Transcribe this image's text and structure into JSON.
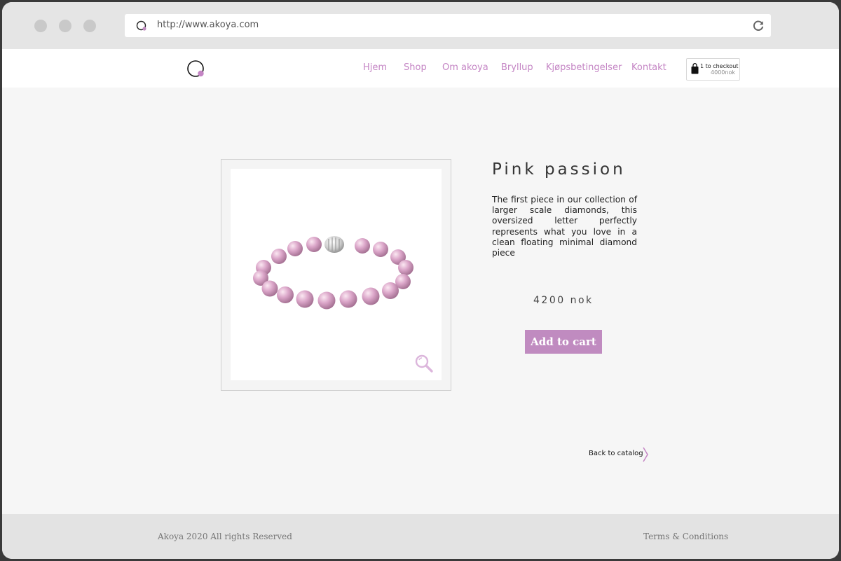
{
  "browser": {
    "url": "http://www.akoya.com",
    "icons": [
      "site-logo-icon",
      "reload-icon"
    ]
  },
  "nav": {
    "items": [
      {
        "label": "Hjem"
      },
      {
        "label": "Shop"
      },
      {
        "label": "Om akoya"
      },
      {
        "label": "Bryllup"
      },
      {
        "label": "Kjøpsbetingelser"
      },
      {
        "label": "Kontakt"
      }
    ]
  },
  "cart": {
    "line1": "1 to checkout",
    "line2": "4000nok"
  },
  "product": {
    "title": "Pink passion",
    "description": "The first piece in our collection of larger scale diamonds, this oversized letter perfectly represents what you love in a clean floating minimal diamond piece",
    "price": "4200 nok",
    "add_label": "Add to cart",
    "back_label": "Back to catalog"
  },
  "footer": {
    "copyright": "Akoya 2020 All rights Reserved",
    "terms": "Terms & Conditions"
  },
  "colors": {
    "accent": "#c08bc0",
    "nav_text": "#c485c4",
    "pearl": "#dba6c9"
  }
}
